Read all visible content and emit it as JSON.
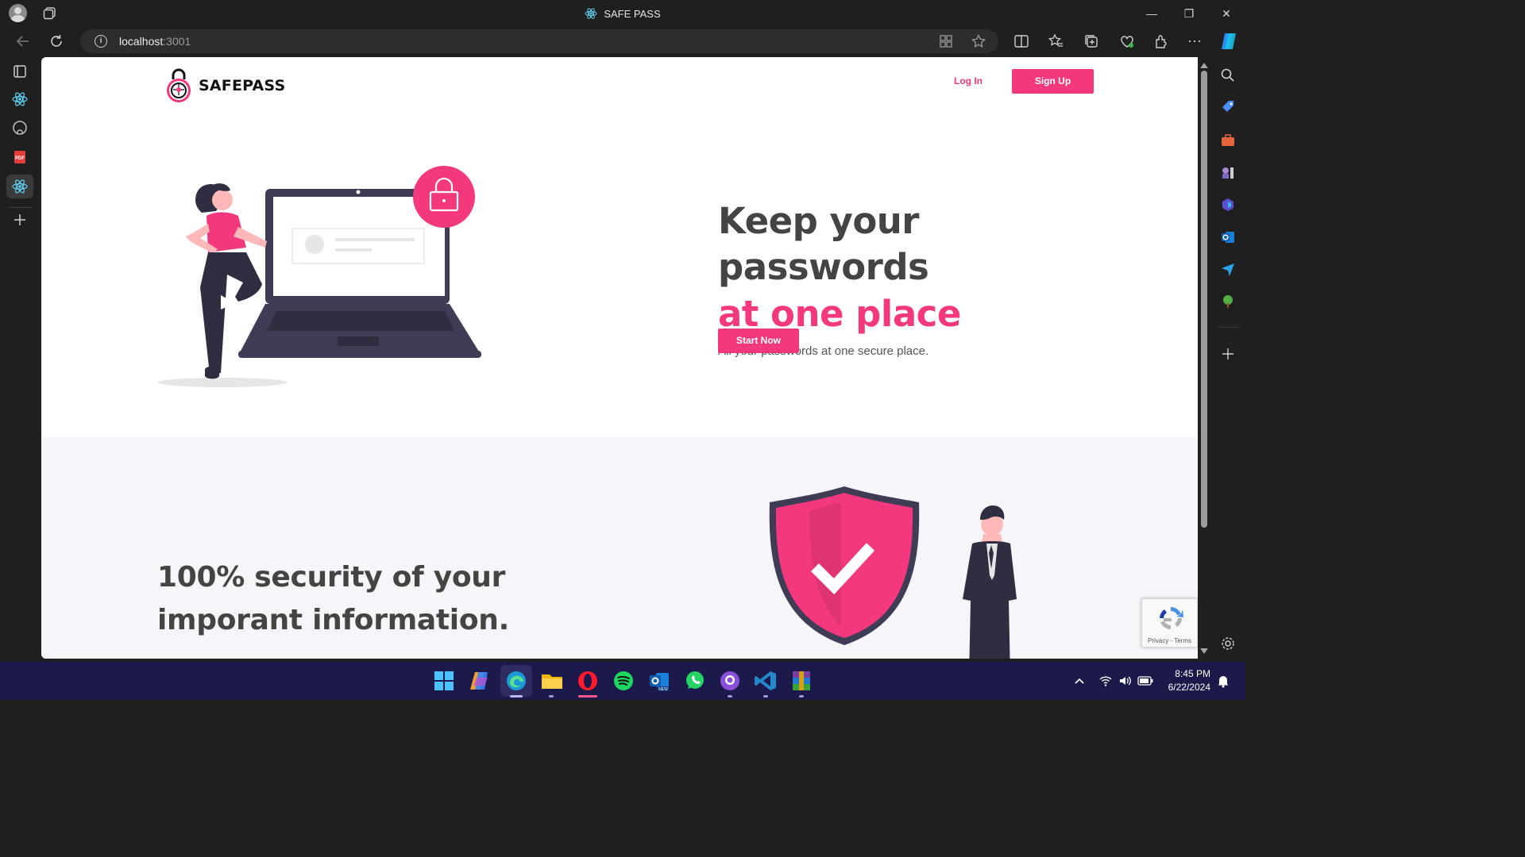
{
  "window": {
    "title": "SAFE PASS",
    "minimize": "—",
    "restore": "❐",
    "close": "✕"
  },
  "address_bar": {
    "host": "localhost",
    "port": ":3001"
  },
  "site": {
    "brand": "SAFEPASS",
    "nav": {
      "login": "Log In",
      "signup": "Sign Up"
    },
    "hero": {
      "title_line1": "Keep your passwords",
      "title_line2": "at one place",
      "subtitle": "All your passwords at one secure place.",
      "cta": "Start Now"
    },
    "section2": {
      "title_line1": "100% security of your",
      "title_line2": "imporant information."
    },
    "recaptcha": {
      "links": "Privacy - Terms"
    }
  },
  "taskbar": {
    "time": "8:45 PM",
    "date": "6/22/2024"
  },
  "colors": {
    "accent": "#f4387d",
    "heading": "#444444",
    "dark_illustration": "#3f3d56",
    "taskbar": "#1c1a4a"
  }
}
